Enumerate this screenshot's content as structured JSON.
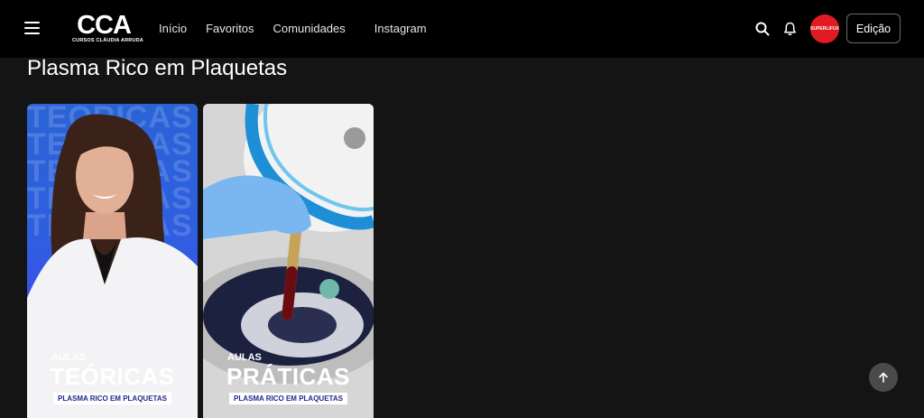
{
  "header": {
    "logo_text": "CCA",
    "logo_subtitle": "CURSOS CLÁUDIA ARRUDA",
    "nav": [
      "Início",
      "Favoritos",
      "Comunidades",
      "Instagram"
    ],
    "avatar_text": "SUPERLIFUX",
    "edit_label": "Edição"
  },
  "page": {
    "title": "Plasma Rico em Plaquetas"
  },
  "cards": [
    {
      "bg_word": "TEÓRICAS",
      "small": "AULAS",
      "big": "TEÓRICAS",
      "box": "PLASMA RICO EM PLAQUETAS"
    },
    {
      "small": "AULAS",
      "big": "PRÁTICAS",
      "box": "PLASMA RICO EM PLAQUETAS"
    }
  ],
  "icons": [
    "menu-icon",
    "search-icon",
    "bell-icon",
    "arrow-up-icon"
  ]
}
